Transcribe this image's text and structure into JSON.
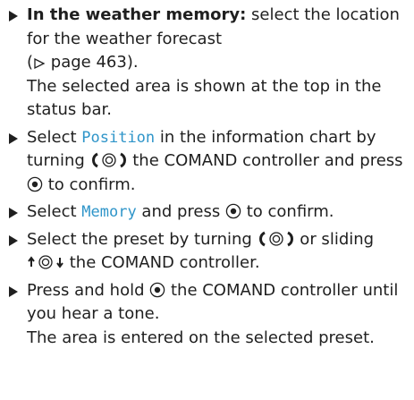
{
  "steps": [
    {
      "bold": "In the weather memory:",
      "t1": " select the location for the weather forecast",
      "t2": "(",
      "page_ref": "page 463",
      "t3": ").",
      "result": "The selected area is shown at the top in the status bar."
    },
    {
      "t1": "Select ",
      "item": "Position",
      "t2": " in the information chart by turning ",
      "t3": " the COMAND controller and press ",
      "t4": " to confirm."
    },
    {
      "t1": "Select ",
      "item": "Memory",
      "t2": " and press ",
      "t3": " to confirm."
    },
    {
      "t1": "Select the preset by turning ",
      "t2": " or sliding ",
      "t3": " the COMAND controller."
    },
    {
      "t1": "Press and hold ",
      "t2": " the COMAND controller until you hear a tone.",
      "result": "The area is entered on the selected preset."
    }
  ],
  "icons": {
    "bullet": "action-arrow-icon",
    "page_ref": "page-reference-triangle-icon",
    "turn": "controller-turn-icon",
    "press": "controller-press-icon",
    "slide": "controller-slide-up-down-icon"
  },
  "colors": {
    "text": "#1f1f1f",
    "highlight": "#2f95c9"
  }
}
